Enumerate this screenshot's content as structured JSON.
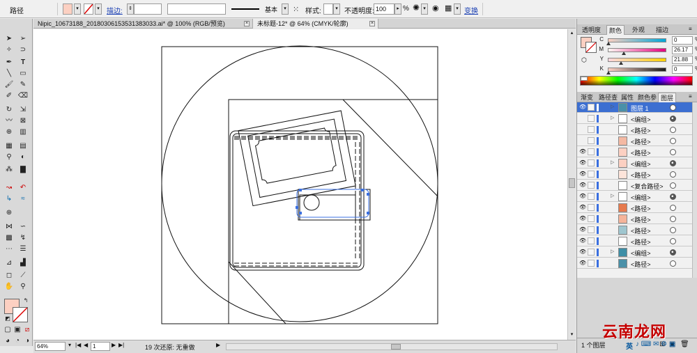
{
  "control": {
    "object_type": "路径",
    "stroke_label": "描边:",
    "stroke_style": "基本",
    "style_label": "样式:",
    "opacity_label": "不透明度:",
    "opacity_value": "100",
    "opacity_unit": "%",
    "transform_label": "变换"
  },
  "tabs": [
    {
      "label": "Nipic_10673188_20180306153531383033.ai* @ 100% (RGB/预览)"
    },
    {
      "label": "未标题-12* @ 64% (CMYK/轮廓)"
    }
  ],
  "color_panel": {
    "tabs": [
      "透明度",
      "颜色",
      "外观",
      "描边"
    ],
    "active_tab": "颜色",
    "channels": [
      {
        "label": "C",
        "value": "0",
        "unit": "%",
        "position": 0.0
      },
      {
        "label": "M",
        "value": "26.17",
        "unit": "%",
        "position": 0.2617
      },
      {
        "label": "Y",
        "value": "21.88",
        "unit": "%",
        "position": 0.2188
      },
      {
        "label": "K",
        "value": "0",
        "unit": "%",
        "position": 0.0
      }
    ],
    "fill_color": "#fcd0c2"
  },
  "layers_panel": {
    "tabs": [
      "渐变",
      "路径查",
      "属性",
      "颜色参",
      "图层"
    ],
    "active_tab": "图层",
    "rows": [
      {
        "name": "图层 1",
        "visible": true,
        "expand": true,
        "thumb": "#4a90a8",
        "target": "open",
        "top": true
      },
      {
        "name": "<编组>",
        "visible": false,
        "expand": true,
        "thumb": "#ffffff",
        "target": "filled"
      },
      {
        "name": "<路径>",
        "visible": false,
        "expand": false,
        "thumb": "#ffffff",
        "target": "open"
      },
      {
        "name": "<路径>",
        "visible": false,
        "expand": false,
        "thumb": "#f4b9a3",
        "target": "open"
      },
      {
        "name": "<路径>",
        "visible": true,
        "expand": false,
        "thumb": "#fcd0c2",
        "target": "open"
      },
      {
        "name": "<编组>",
        "visible": true,
        "expand": true,
        "thumb": "#fcd0c2",
        "target": "filled"
      },
      {
        "name": "<路径>",
        "visible": true,
        "expand": false,
        "thumb": "#fde4da",
        "target": "open"
      },
      {
        "name": "<复合路径>",
        "visible": true,
        "expand": false,
        "thumb": "#ffffff",
        "target": "open"
      },
      {
        "name": "<编组>",
        "visible": true,
        "expand": true,
        "thumb": "#ffffff",
        "target": "filled"
      },
      {
        "name": "<路径>",
        "visible": true,
        "expand": false,
        "thumb": "#e67a4e",
        "target": "open"
      },
      {
        "name": "<路径>",
        "visible": true,
        "expand": false,
        "thumb": "#f5b49a",
        "target": "open"
      },
      {
        "name": "<路径>",
        "visible": true,
        "expand": false,
        "thumb": "#9fc6cf",
        "target": "open"
      },
      {
        "name": "<路径>",
        "visible": true,
        "expand": false,
        "thumb": "#ffffff",
        "target": "open"
      },
      {
        "name": "<编组>",
        "visible": true,
        "expand": true,
        "thumb": "#3e8ea6",
        "target": "filled"
      },
      {
        "name": "<路径>",
        "visible": true,
        "expand": false,
        "thumb": "#4a90a8",
        "target": "open"
      }
    ],
    "footer": "1 个图层"
  },
  "status": {
    "zoom": "64%",
    "page": "1",
    "undo": "19 次还原: 无重做"
  },
  "colors": {
    "selection_blue": "#3a6fe0"
  },
  "watermark": "云南龙网"
}
